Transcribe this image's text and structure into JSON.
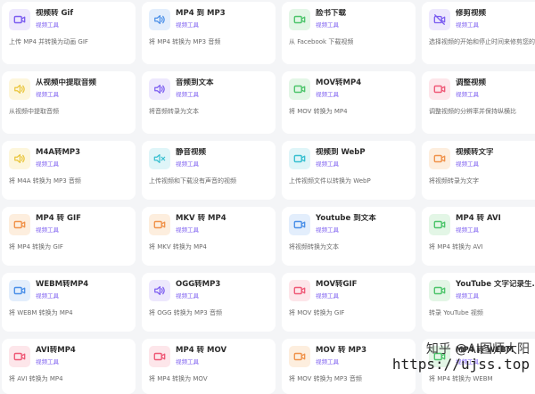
{
  "colors": {
    "purple_bg": "#ede8fd",
    "purple_fg": "#7b5cf0",
    "green_bg": "#e3f6e6",
    "green_fg": "#4cc46a",
    "yellow_bg": "#fdf6dc",
    "yellow_fg": "#e9c53b",
    "red_bg": "#fde6ea",
    "red_fg": "#ef5876",
    "cyan_bg": "#dff5f8",
    "cyan_fg": "#36bfd0",
    "orange_bg": "#fdeede",
    "orange_fg": "#f0924a",
    "blue_bg": "#e3eefc",
    "blue_fg": "#4a8fe8"
  },
  "tools": [
    {
      "title": "视频转 Gif",
      "tag": "视频工具",
      "desc": "上传 MP4 并转换为动画 GIF",
      "icon": "video-camera-icon",
      "color": "purple"
    },
    {
      "title": "MP4 到 MP3",
      "tag": "视频工具",
      "desc": "将 MP4 转换为 MP3 音频",
      "icon": "speaker-icon",
      "color": "blue"
    },
    {
      "title": "脸书下载",
      "tag": "视频工具",
      "desc": "从 Facebook 下载视频",
      "icon": "video-camera-icon",
      "color": "green"
    },
    {
      "title": "修剪视频",
      "tag": "视频工具",
      "desc": "选择视频的开始和停止时间来修剪您的视频",
      "icon": "no-video-icon",
      "color": "purple"
    },
    {
      "title": "从视频中提取音频",
      "tag": "视频工具",
      "desc": "从视频中提取音频",
      "icon": "speaker-icon",
      "color": "yellow"
    },
    {
      "title": "音频到文本",
      "tag": "视频工具",
      "desc": "将音频转录为文本",
      "icon": "speaker-icon",
      "color": "purple"
    },
    {
      "title": "MOV转MP4",
      "tag": "视频工具",
      "desc": "将 MOV 转换为 MP4",
      "icon": "video-camera-icon",
      "color": "green"
    },
    {
      "title": "调整视频",
      "tag": "视频工具",
      "desc": "调整视频的分辨率并保持纵横比",
      "icon": "video-camera-icon",
      "color": "red"
    },
    {
      "title": "M4A转MP3",
      "tag": "视频工具",
      "desc": "将 M4A 转换为 MP3 音频",
      "icon": "speaker-icon",
      "color": "yellow"
    },
    {
      "title": "静音视频",
      "tag": "视频工具",
      "desc": "上传视频和下载没有声音的视频",
      "icon": "mute-speaker-icon",
      "color": "cyan"
    },
    {
      "title": "视频到 WebP",
      "tag": "视频工具",
      "desc": "上传视频文件以转换为 WebP",
      "icon": "video-camera-icon",
      "color": "cyan"
    },
    {
      "title": "视频转文字",
      "tag": "视频工具",
      "desc": "将视频转录为文字",
      "icon": "video-camera-icon",
      "color": "orange"
    },
    {
      "title": "MP4 转 GIF",
      "tag": "视频工具",
      "desc": "将 MP4 转换为 GIF",
      "icon": "video-camera-icon",
      "color": "orange"
    },
    {
      "title": "MKV 转 MP4",
      "tag": "视频工具",
      "desc": "将 MKV 转换为 MP4",
      "icon": "video-camera-icon",
      "color": "orange"
    },
    {
      "title": "Youtube 到文本",
      "tag": "视频工具",
      "desc": "将视频转换为文本",
      "icon": "video-camera-icon",
      "color": "blue"
    },
    {
      "title": "MP4 转 AVI",
      "tag": "视频工具",
      "desc": "将 MP4 转换为 AVI",
      "icon": "video-camera-icon",
      "color": "green"
    },
    {
      "title": "WEBM转MP4",
      "tag": "视频工具",
      "desc": "将 WEBM 转换为 MP4",
      "icon": "video-camera-icon",
      "color": "blue"
    },
    {
      "title": "OGG转MP3",
      "tag": "视频工具",
      "desc": "将 OGG 转换为 MP3 音频",
      "icon": "speaker-icon",
      "color": "purple"
    },
    {
      "title": "MOV转GIF",
      "tag": "视频工具",
      "desc": "将 MOV 转换为 GIF",
      "icon": "video-camera-icon",
      "color": "red"
    },
    {
      "title": "YouTube 文字记录生...",
      "tag": "视频工具",
      "desc": "转录 YouTube 视频",
      "icon": "video-camera-icon",
      "color": "green"
    },
    {
      "title": "AVI转MP4",
      "tag": "视频工具",
      "desc": "将 AVI 转换为 MP4",
      "icon": "video-camera-icon",
      "color": "red"
    },
    {
      "title": "MP4 转 MOV",
      "tag": "视频工具",
      "desc": "将 MP4 转换为 MOV",
      "icon": "video-camera-icon",
      "color": "red"
    },
    {
      "title": "MOV 转 MP3",
      "tag": "视频工具",
      "desc": "将 MOV 转换为 MP3 音频",
      "icon": "video-camera-icon",
      "color": "orange"
    },
    {
      "title": "MP4 转 WEBM",
      "tag": "视频工具",
      "desc": "将 MP4 转换为 WEBM",
      "icon": "video-camera-icon",
      "color": "green"
    }
  ],
  "watermark": {
    "line1": "知乎 @AI图师大阳",
    "line2": "https://ujss.top"
  }
}
